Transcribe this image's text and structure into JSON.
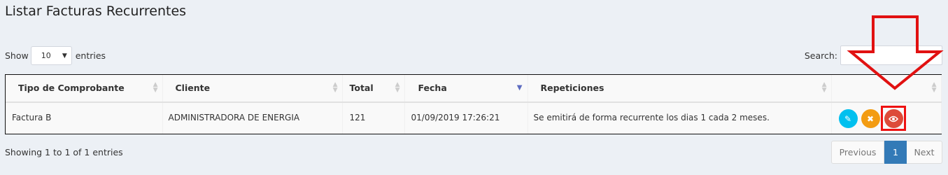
{
  "page": {
    "title": "Listar Facturas Recurrentes"
  },
  "length_control": {
    "show_label": "Show",
    "selected": "10",
    "entries_label": "entries"
  },
  "search": {
    "label": "Search:",
    "value": ""
  },
  "table": {
    "headers": [
      "Tipo de Comprobante",
      "Cliente",
      "Total",
      "Fecha",
      "Repeticiones",
      ""
    ],
    "sorted_column": "Fecha",
    "rows": [
      {
        "tipo": "Factura B",
        "cliente": "ADMINISTRADORA DE ENERGIA",
        "total": "121",
        "fecha": "01/09/2019 17:26:21",
        "repeticiones": "Se emitirá de forma recurrente los dias 1 cada 2 meses.",
        "actions": [
          {
            "name": "edit",
            "icon": "pencil-icon",
            "color": "#00c0ef"
          },
          {
            "name": "delete",
            "icon": "x-icon",
            "color": "#f39c12"
          },
          {
            "name": "view",
            "icon": "eye-icon",
            "color": "#dd4b39"
          }
        ]
      }
    ]
  },
  "footer": {
    "info": "Showing 1 to 1 of 1 entries"
  },
  "pagination": {
    "previous": "Previous",
    "current": "1",
    "next": "Next"
  },
  "annotation": {
    "color": "#e11111",
    "highlight": "view-button"
  }
}
